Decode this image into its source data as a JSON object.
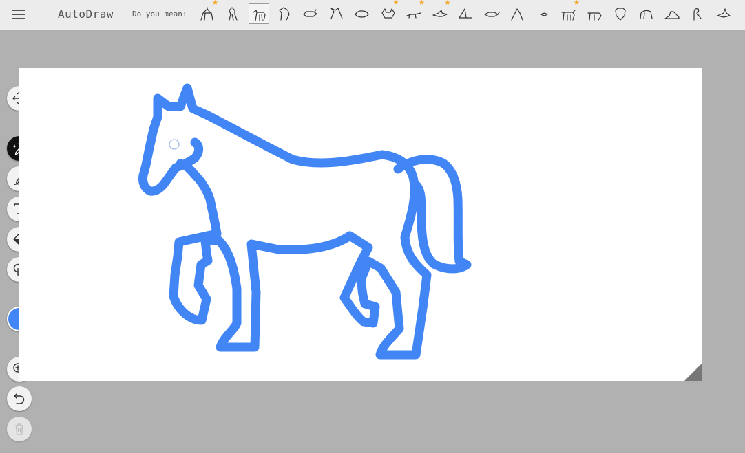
{
  "app": {
    "title": "AutoDraw"
  },
  "header": {
    "did_you_mean_label": "Do you mean:",
    "suggestions": [
      {
        "icon": "giraffe-icon",
        "starred": true,
        "selected": false
      },
      {
        "icon": "rearing-horse-icon",
        "starred": false,
        "selected": false
      },
      {
        "icon": "horse-icon",
        "starred": false,
        "selected": true
      },
      {
        "icon": "horse-head-icon",
        "starred": false,
        "selected": false
      },
      {
        "icon": "rhino-icon",
        "starred": false,
        "selected": false
      },
      {
        "icon": "dragon-icon",
        "starred": false,
        "selected": false
      },
      {
        "icon": "hippo-icon",
        "starred": false,
        "selected": false
      },
      {
        "icon": "fox-icon",
        "starred": true,
        "selected": false
      },
      {
        "icon": "lizard-icon",
        "starred": true,
        "selected": false
      },
      {
        "icon": "shark-icon",
        "starred": true,
        "selected": false
      },
      {
        "icon": "fin-icon",
        "starred": false,
        "selected": false
      },
      {
        "icon": "fish-icon",
        "starred": false,
        "selected": false
      },
      {
        "icon": "dinosaur-icon",
        "starred": false,
        "selected": false
      },
      {
        "icon": "small-fish-icon",
        "starred": false,
        "selected": false
      },
      {
        "icon": "cow-icon",
        "starred": true,
        "selected": false
      },
      {
        "icon": "dog-icon",
        "starred": false,
        "selected": false
      },
      {
        "icon": "cow-face-icon",
        "starred": false,
        "selected": false
      },
      {
        "icon": "elephant-icon",
        "starred": false,
        "selected": false
      },
      {
        "icon": "shoe-icon",
        "starred": false,
        "selected": false
      },
      {
        "icon": "swan-icon",
        "starred": false,
        "selected": false
      },
      {
        "icon": "hand-icon",
        "starred": false,
        "selected": false
      }
    ]
  },
  "toolbar": {
    "tools": [
      {
        "name": "move-tool",
        "icon": "move-icon",
        "state": "normal"
      },
      {
        "name": "autodraw-tool",
        "icon": "autodraw-icon",
        "state": "active"
      },
      {
        "name": "draw-tool",
        "icon": "pencil-icon",
        "state": "normal"
      },
      {
        "name": "type-tool",
        "icon": "text-icon",
        "state": "normal"
      },
      {
        "name": "fill-tool",
        "icon": "fill-bucket-icon",
        "state": "normal"
      },
      {
        "name": "shape-tool",
        "icon": "shapes-icon",
        "state": "normal"
      },
      {
        "name": "color-picker",
        "icon": "color-swatch",
        "state": "normal"
      },
      {
        "name": "zoom-tool",
        "icon": "zoom-in-icon",
        "state": "normal"
      },
      {
        "name": "undo-tool",
        "icon": "undo-icon",
        "state": "normal"
      },
      {
        "name": "delete-tool",
        "icon": "trash-icon",
        "state": "disabled"
      }
    ],
    "current_color": "#4285f4"
  },
  "canvas": {
    "background": "#ffffff",
    "stroke_color": "#4285f4",
    "drawing": "horse"
  }
}
